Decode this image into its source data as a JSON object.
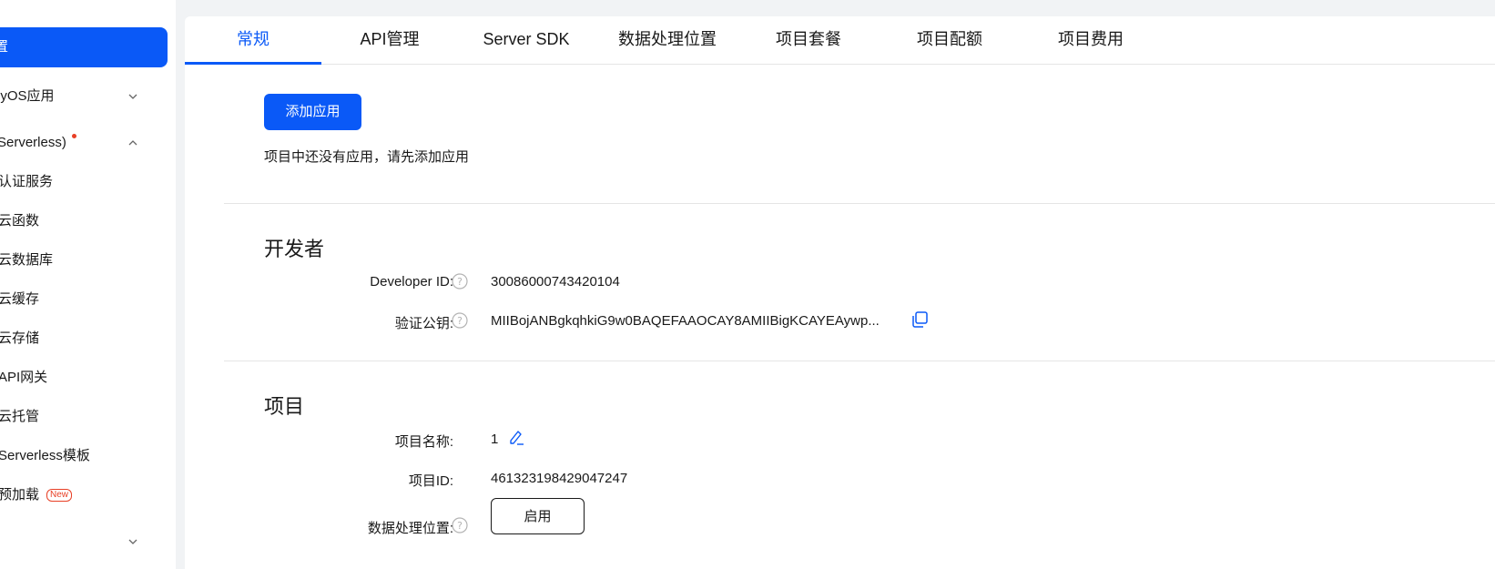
{
  "sidebar": {
    "active_label": "置",
    "items": [
      {
        "label": "nyOS应用"
      },
      {
        "label": "(Serverless)"
      },
      {
        "label": "认证服务"
      },
      {
        "label": "云函数"
      },
      {
        "label": "云数据库"
      },
      {
        "label": "云缓存"
      },
      {
        "label": "云存储"
      },
      {
        "label": "API网关"
      },
      {
        "label": "云托管"
      },
      {
        "label": "Serverless模板"
      },
      {
        "label": "预加载",
        "badge": "New"
      }
    ]
  },
  "tabs": [
    {
      "label": "常规"
    },
    {
      "label": "API管理"
    },
    {
      "label": "Server SDK"
    },
    {
      "label": "数据处理位置"
    },
    {
      "label": "项目套餐"
    },
    {
      "label": "项目配额"
    },
    {
      "label": "项目费用"
    }
  ],
  "apps": {
    "add_button": "添加应用",
    "empty_text": "项目中还没有应用，请先添加应用"
  },
  "developer": {
    "title": "开发者",
    "id_label": "Developer ID:",
    "id_value": "30086000743420104",
    "key_label": "验证公钥:",
    "key_value": "MIIBojANBgkqhkiG9w0BAQEFAAOCAY8AMIIBigKCAYEAywp..."
  },
  "project": {
    "title": "项目",
    "name_label": "项目名称:",
    "name_value": "1",
    "id_label": "项目ID:",
    "id_value": "461323198429047247",
    "location_label": "数据处理位置:",
    "enable_button": "启用"
  },
  "colors": {
    "accent": "#0a59f7",
    "badge": "#e84026",
    "background": "#f1f3f5"
  }
}
